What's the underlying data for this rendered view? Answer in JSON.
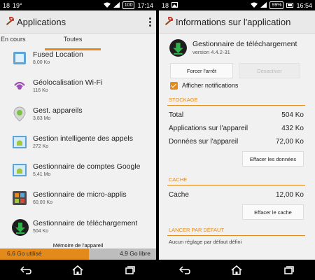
{
  "left": {
    "status": {
      "left_items": [
        "18",
        "19°"
      ],
      "right_value": "100",
      "time": "17:14"
    },
    "title": "Applications",
    "tabs": [
      "En cours",
      "Toutes"
    ],
    "apps": [
      {
        "name": "Fused Location",
        "size": "8,00 Ko",
        "icon": "fused-location-icon"
      },
      {
        "name": "Géolocalisation Wi-Fi",
        "size": "116 Ko",
        "icon": "wifi-location-icon"
      },
      {
        "name": "Gest. appareils",
        "size": "3,83 Mo",
        "icon": "device-manager-icon"
      },
      {
        "name": "Gestion intelligente des appels",
        "size": "272 Ko",
        "icon": "android-app-icon"
      },
      {
        "name": "Gestionnaire de comptes Google",
        "size": "5,41 Mo",
        "icon": "android-app-icon"
      },
      {
        "name": "Gestionnaire de micro-applis",
        "size": "60,00 Ko",
        "icon": "micro-apps-icon"
      },
      {
        "name": "Gestionnaire de téléchargement",
        "size": "504 Ko",
        "icon": "download-icon"
      }
    ],
    "memory": {
      "label": "Mémoire de l'appareil",
      "used": "6,6 Go utilisé",
      "free": "4,9 Go libre",
      "used_fraction": 0.57
    }
  },
  "right": {
    "status": {
      "left_items": [
        "18"
      ],
      "right_value": "99%",
      "time": "16:54"
    },
    "title": "Informations sur l'application",
    "app_name": "Gestionnaire de téléchargement",
    "version": "version 4.4.2-31",
    "force_stop": "Forcer l'arrêt",
    "disable": "Désactiver",
    "notifications": "Afficher notifications",
    "storage_header": "STOCKAGE",
    "storage": [
      {
        "label": "Total",
        "value": "504 Ko"
      },
      {
        "label": "Applications sur l'appareil",
        "value": "432 Ko"
      },
      {
        "label": "Données sur l'appareil",
        "value": "72,00 Ko"
      }
    ],
    "clear_data": "Effacer les données",
    "cache_header": "CACHE",
    "cache_label": "Cache",
    "cache_value": "12,00 Ko",
    "clear_cache": "Effacer le cache",
    "default_header": "LANCER PAR DÉFAUT",
    "default_text": "Aucun réglage par défaut défini"
  },
  "colors": {
    "accent": "#e38a1a",
    "android_green": "#a4c639",
    "download_green": "#2db34a"
  }
}
